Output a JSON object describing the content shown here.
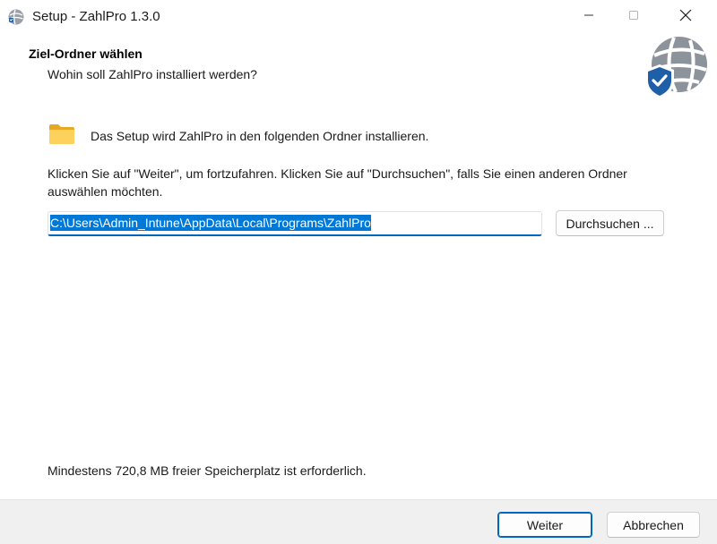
{
  "window": {
    "title": "Setup - ZahlPro 1.3.0",
    "app_icon": "globe-shield-icon",
    "controls": {
      "minimize": "minimize-icon",
      "maximize": "maximize-icon",
      "close": "close-icon"
    }
  },
  "header": {
    "title": "Ziel-Ordner wählen",
    "subtitle": "Wohin soll ZahlPro installiert werden?",
    "logo": "globe-shield-logo"
  },
  "content": {
    "folder_icon": "folder-icon",
    "intro": "Das Setup wird ZahlPro in den folgenden Ordner installieren.",
    "instruction": "Klicken Sie auf \"Weiter\", um fortzufahren. Klicken Sie auf \"Durchsuchen\", falls Sie einen anderen Ordner auswählen möchten.",
    "path_value": "C:\\Users\\Admin_Intune\\AppData\\Local\\Programs\\ZahlPro",
    "browse_label": "Durchsuchen ...",
    "space_required": "Mindestens 720,8 MB freier Speicherplatz ist erforderlich."
  },
  "footer": {
    "next_label": "Weiter",
    "cancel_label": "Abbrechen"
  },
  "colors": {
    "accent": "#0067c0",
    "selection": "#0078d7",
    "shield": "#1f5fa8",
    "folder": "#f8c94a",
    "footer_bg": "#f0f0f0"
  }
}
